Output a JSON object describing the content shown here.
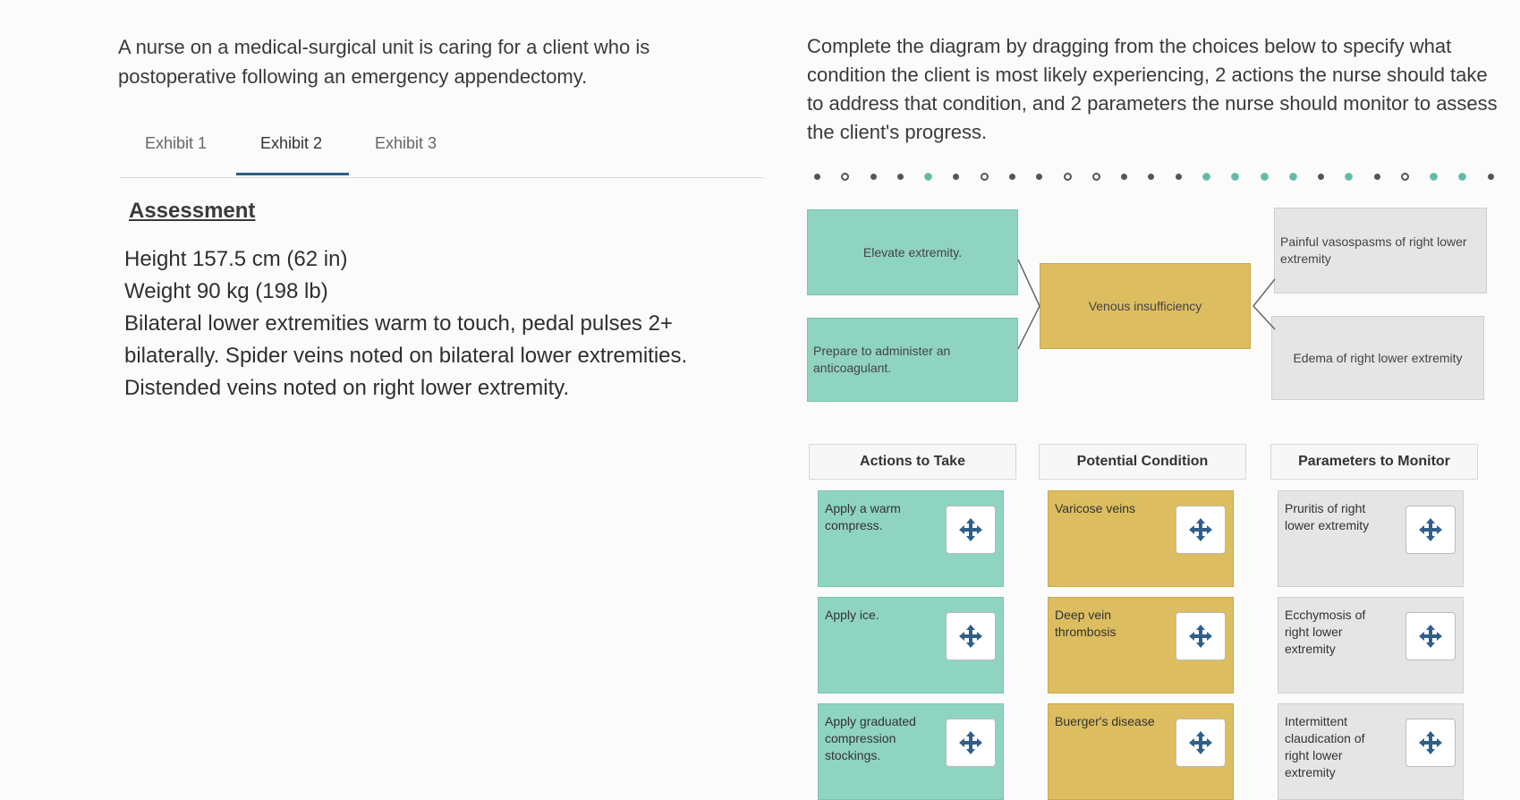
{
  "question": {
    "intro": "A nurse on a medical-surgical unit is caring for a client who is postoperative following an emergency appendectomy.",
    "instructions": "Complete the diagram by dragging from the choices below to specify what condition the client is most likely experiencing, 2 actions the nurse should take to address that condition, and 2 parameters the nurse should monitor to assess the client's progress."
  },
  "tabs": [
    {
      "label": "Exhibit 1"
    },
    {
      "label": "Exhibit 2",
      "active": true
    },
    {
      "label": "Exhibit 3"
    }
  ],
  "assessment": {
    "heading": "Assessment",
    "lines": [
      "Height 157.5 cm (62 in)",
      "Weight 90 kg (198 lb)",
      "Bilateral lower extremities warm to touch, pedal pulses 2+",
      "bilaterally. Spider veins noted on bilateral lower extremities.",
      "Distended veins noted on right lower extremity."
    ]
  },
  "diagram": {
    "action_1": "Elevate extremity.",
    "action_2": "Prepare to administer an anticoagulant.",
    "condition": "Venous insufficiency",
    "parameter_1": "Painful vasospasms of right lower extremity",
    "parameter_2": "Edema of right lower extremity"
  },
  "columns": {
    "actions": {
      "header": "Actions to Take",
      "items": [
        "Apply a warm compress.",
        "Apply ice.",
        "Apply graduated compression stockings."
      ]
    },
    "conditions": {
      "header": "Potential Condition",
      "items": [
        "Varicose veins",
        "Deep vein thrombosis",
        "Buerger's disease"
      ]
    },
    "parameters": {
      "header": "Parameters to Monitor",
      "items": [
        "Pruritis of right lower extremity",
        "Ecchymosis of right lower extremity",
        "Intermittent claudication of right lower extremity"
      ]
    }
  },
  "colors": {
    "action": "#8fd3c1",
    "condition": "#dcbd5f",
    "parameter": "#e5e5e5",
    "tab_underline": "#2b5f86"
  },
  "icons": {
    "drag_handle": "move-arrows-icon"
  }
}
